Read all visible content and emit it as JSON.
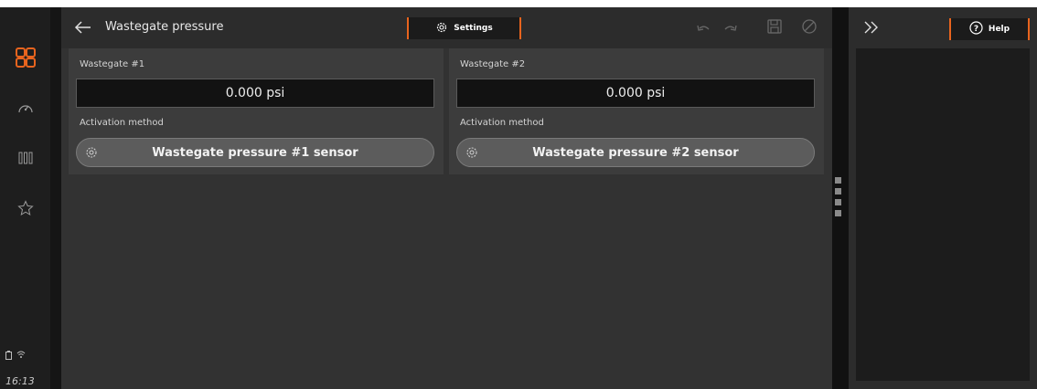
{
  "header": {
    "title": "Wastegate pressure",
    "settings_label": "Settings"
  },
  "cards": [
    {
      "label": "Wastegate #1",
      "value": "0.000 psi",
      "method_label": "Activation method",
      "method_value": "Wastegate pressure #1 sensor"
    },
    {
      "label": "Wastegate #2",
      "value": "0.000 psi",
      "method_label": "Activation method",
      "method_value": "Wastegate pressure #2 sensor"
    }
  ],
  "right_panel": {
    "help_label": "Help"
  },
  "status": {
    "clock": "16:13"
  },
  "icons": [
    "apps-grid-icon",
    "gauge-icon",
    "columns-icon",
    "star-icon",
    "battery-icon",
    "wifi-icon",
    "back-arrow-icon",
    "gear-icon",
    "undo-icon",
    "redo-icon",
    "save-icon",
    "cancel-icon",
    "collapse-right-icon",
    "help-icon"
  ],
  "colors": {
    "accent": "#e8641e",
    "panel": "#323232",
    "card": "#3c3c3c"
  }
}
